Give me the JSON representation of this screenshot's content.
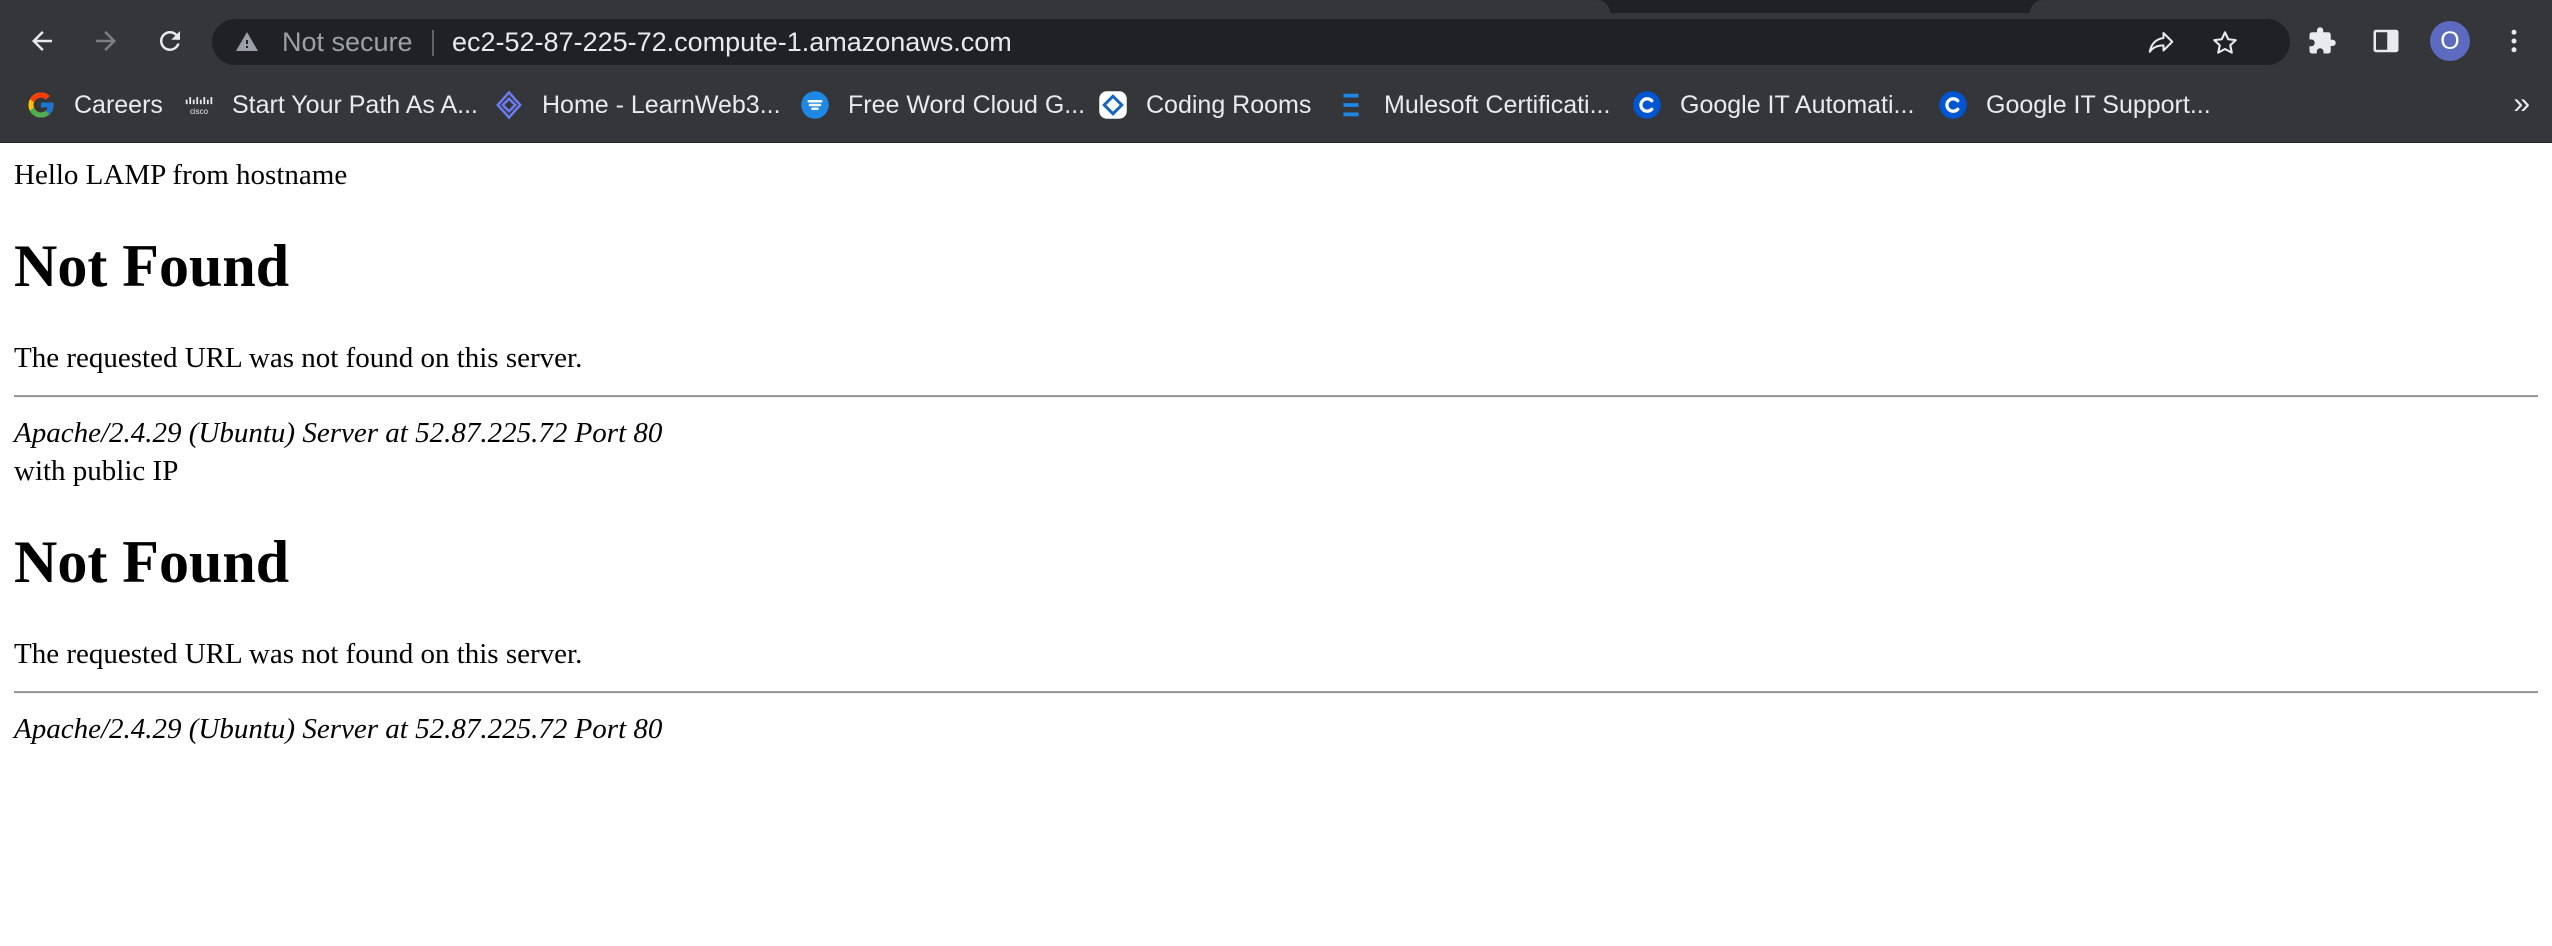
{
  "toolbar": {
    "back_icon": "back-arrow-icon",
    "forward_icon": "forward-arrow-icon",
    "reload_icon": "reload-icon",
    "security_label": "Not secure",
    "url": "ec2-52-87-225-72.compute-1.amazonaws.com",
    "share_icon": "share-icon",
    "bookmark_star_icon": "star-icon",
    "extensions_icon": "puzzle-icon",
    "side_panel_icon": "side-panel-icon",
    "profile_initial": "O",
    "menu_icon": "kebab-menu-icon"
  },
  "bookmarks": [
    {
      "label": "Careers",
      "icon": "google-icon"
    },
    {
      "label": "Start Your Path As A...",
      "icon": "cisco-icon"
    },
    {
      "label": "Home - LearnWeb3...",
      "icon": "learnweb3-icon"
    },
    {
      "label": "Free Word Cloud G...",
      "icon": "word-cloud-icon"
    },
    {
      "label": "Coding Rooms",
      "icon": "coding-rooms-icon"
    },
    {
      "label": "Mulesoft Certificati...",
      "icon": "mulesoft-icon"
    },
    {
      "label": "Google IT Automati...",
      "icon": "coursera-icon"
    },
    {
      "label": "Google IT Support...",
      "icon": "coursera-icon"
    }
  ],
  "bookmarks_overflow": "»",
  "content": {
    "intro": "Hello LAMP from hostname",
    "block1": {
      "heading": "Not Found",
      "message": "The requested URL was not found on this server.",
      "address": "Apache/2.4.29 (Ubuntu) Server at 52.87.225.72 Port 80"
    },
    "middle": "with public IP",
    "block2": {
      "heading": "Not Found",
      "message": "The requested URL was not found on this server.",
      "address": "Apache/2.4.29 (Ubuntu) Server at 52.87.225.72 Port 80"
    }
  },
  "colors": {
    "chrome_bg": "#35363a",
    "omnibox_bg": "#202124",
    "chrome_text": "#e8eaed",
    "muted_text": "#9aa0a6",
    "avatar_bg": "#5c6bc0"
  }
}
